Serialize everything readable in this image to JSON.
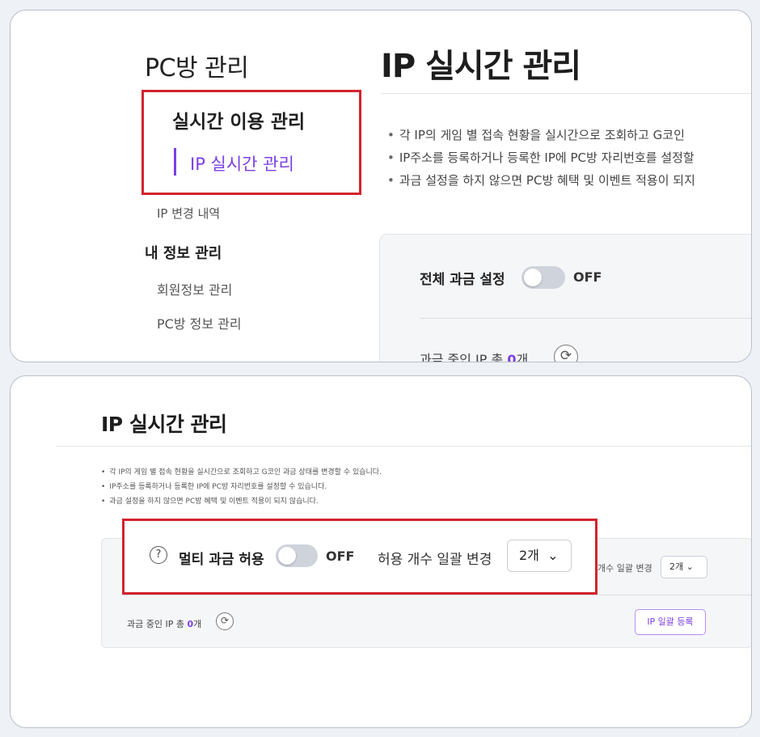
{
  "top": {
    "sidebar": {
      "title": "PC방 관리",
      "section_realtime": "실시간 이용 관리",
      "item_ip_realtime": "IP 실시간 관리",
      "item_ip_change": "IP 변경 내역",
      "section_myinfo": "내 정보 관리",
      "item_member": "회원정보 관리",
      "item_pcbang": "PC방 정보 관리"
    },
    "main": {
      "title": "IP 실시간 관리",
      "bullets": [
        "각 IP의 게임 별 접속 현황을 실시간으로 조회하고 G코인 ",
        "IP주소를 등록하거나 등록한 IP에 PC방 자리번호를 설정할",
        "과금 설정을 하지 않으면 PC방 혜택 및 이벤트 적용이 되지"
      ],
      "charge_label": "전체 과금 설정",
      "charge_state": "OFF",
      "count_prefix": "과금 중인 IP 총 ",
      "count_value": "0",
      "count_suffix": "개"
    }
  },
  "bottom": {
    "title": "IP 실시간 관리",
    "bullets": [
      "각 IP의 게임 별 접속 현황을 실시간으로 조회하고 G코인 과금 상태를 변경할 수 있습니다.",
      "IP주소를 등록하거나 등록한 IP에 PC방 자리번호를 설정할 수 있습니다.",
      "과금 설정을 하지 않으면 PC방 혜택 및 이벤트 적용이 되지 않습니다."
    ],
    "multi_label": "멀티 과금 허용",
    "multi_state": "OFF",
    "allow_label": "허용 개수 일괄 변경",
    "allow_value": "2개",
    "partial_label": "개수 일괄 변경",
    "partial_value": "2개",
    "count_prefix": "과금 중인 IP 총 ",
    "count_value": "0",
    "count_suffix": "개",
    "bulk_register": "IP 일괄 등록"
  },
  "icons": {
    "help": "question-circle-icon",
    "refresh": "refresh-icon",
    "dropdown": "chevron-down-icon"
  },
  "colors": {
    "accent": "#7b3fe4",
    "highlight_box": "#d3232d",
    "toggle_off": "#cfd4dc"
  }
}
